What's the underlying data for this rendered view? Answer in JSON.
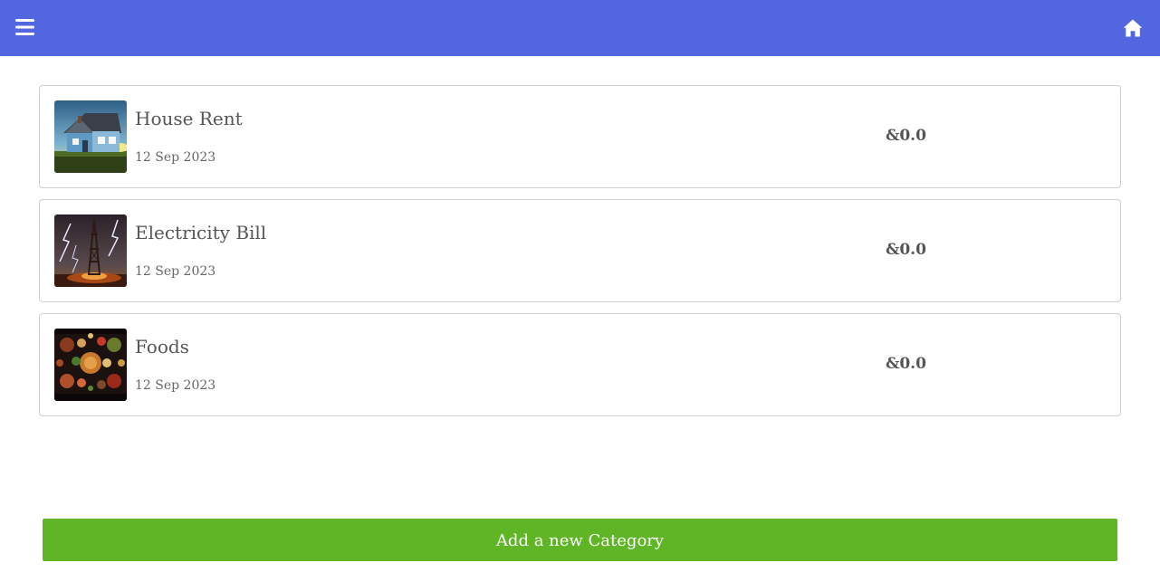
{
  "header": {
    "menu_icon": "hamburger-menu-icon",
    "home_icon": "home-icon",
    "background_color": "#5266e0"
  },
  "categories": [
    {
      "name": "House Rent",
      "date": "12 Sep 2023",
      "amount": "&0.0",
      "image": "house-photo"
    },
    {
      "name": "Electricity Bill",
      "date": "12 Sep 2023",
      "amount": "&0.0",
      "image": "electricity-tower-lightning-photo"
    },
    {
      "name": "Foods",
      "date": "12 Sep 2023",
      "amount": "&0.0",
      "image": "food-platter-photo"
    }
  ],
  "footer": {
    "add_button_label": "Add a new Category",
    "add_button_color": "#5fb526"
  }
}
